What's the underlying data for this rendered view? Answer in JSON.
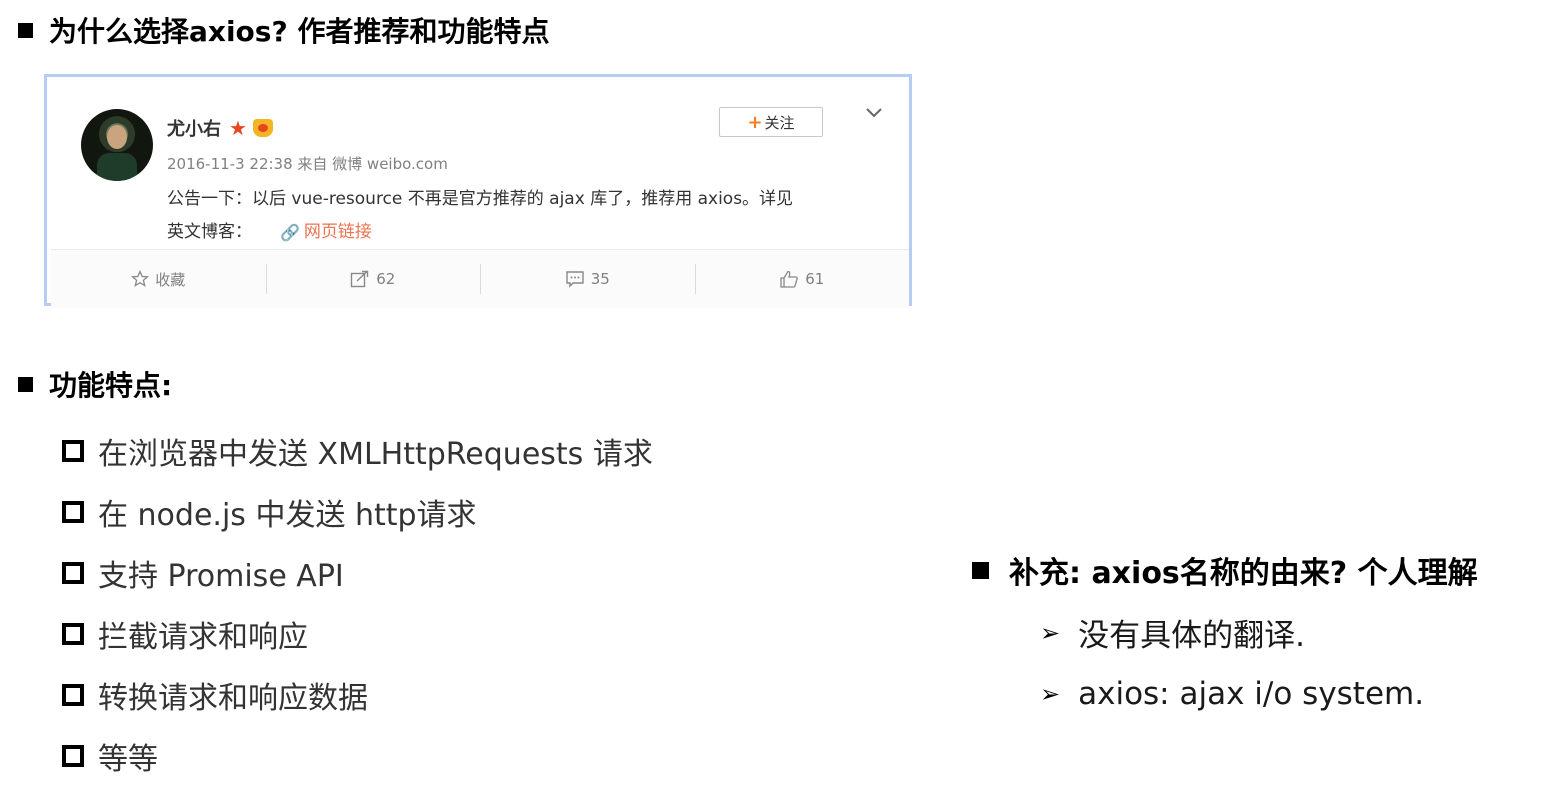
{
  "headings": {
    "why": "为什么选择axios? 作者推荐和功能特点",
    "features": "功能特点:",
    "supplement": "补充: axios名称的由来? 个人理解"
  },
  "weibo": {
    "username": "尤小右",
    "timestamp": "2016-11-3 22:38 来自 微博 weibo.com",
    "text_line1": "公告一下：以后 vue-resource 不再是官方推荐的 ajax 库了，推荐用 axios。详见",
    "text_line2": "英文博客：",
    "link_text": "网页链接",
    "follow_label": "关注",
    "actions": {
      "favorite": "收藏",
      "repost": "62",
      "comment": "35",
      "like": "61"
    },
    "colors": {
      "link": "#eb7350",
      "star": "#e8461e",
      "border": "#b7cdef"
    }
  },
  "features": [
    "在浏览器中发送 XMLHttpRequests 请求",
    "在 node.js 中发送 http请求",
    "支持 Promise API",
    "拦截请求和响应",
    "转换请求和响应数据",
    "等等"
  ],
  "supplement": [
    "没有具体的翻译.",
    "axios: ajax i/o system."
  ]
}
